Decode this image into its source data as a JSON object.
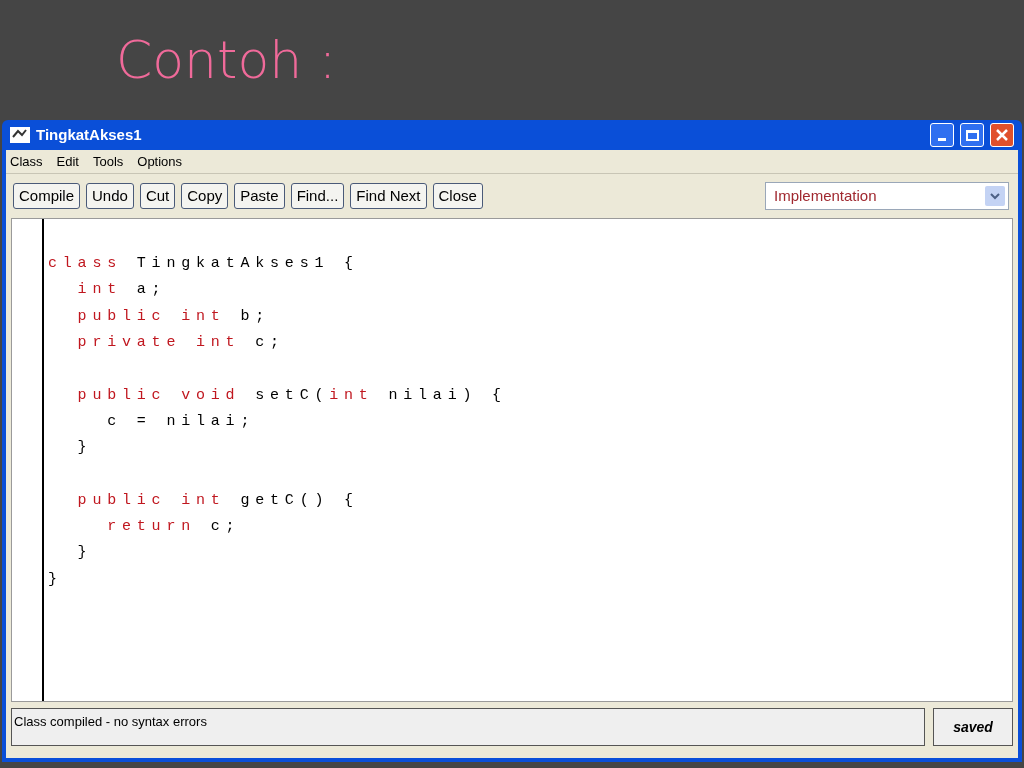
{
  "slide": {
    "title": "Contoh :"
  },
  "window": {
    "title": "TingkatAkses1"
  },
  "menu": [
    "Class",
    "Edit",
    "Tools",
    "Options"
  ],
  "toolbar": [
    "Compile",
    "Undo",
    "Cut",
    "Copy",
    "Paste",
    "Find...",
    "Find Next",
    "Close"
  ],
  "view_select": {
    "value": "Implementation"
  },
  "code": [
    {
      "blank": true
    },
    {
      "tokens": [
        {
          "kind": "keyword",
          "text": "class"
        },
        {
          "kind": "plain",
          "text": " TingkatAkses1 {"
        }
      ]
    },
    {
      "tokens": [
        {
          "kind": "keyword",
          "text": "  int"
        },
        {
          "kind": "plain",
          "text": " a;"
        }
      ]
    },
    {
      "tokens": [
        {
          "kind": "keyword",
          "text": "  public int"
        },
        {
          "kind": "plain",
          "text": " b;"
        }
      ]
    },
    {
      "tokens": [
        {
          "kind": "keyword",
          "text": "  private int"
        },
        {
          "kind": "plain",
          "text": " c;"
        }
      ]
    },
    {
      "blank": true
    },
    {
      "tokens": [
        {
          "kind": "keyword",
          "text": "  public void"
        },
        {
          "kind": "plain",
          "text": " setC("
        },
        {
          "kind": "keyword",
          "text": "int"
        },
        {
          "kind": "plain",
          "text": " nilai) {"
        }
      ]
    },
    {
      "tokens": [
        {
          "kind": "plain",
          "text": "    c = nilai;"
        }
      ]
    },
    {
      "tokens": [
        {
          "kind": "plain",
          "text": "  }"
        }
      ]
    },
    {
      "blank": true
    },
    {
      "tokens": [
        {
          "kind": "keyword",
          "text": "  public int"
        },
        {
          "kind": "plain",
          "text": " getC() {"
        }
      ]
    },
    {
      "tokens": [
        {
          "kind": "keyword",
          "text": "    return"
        },
        {
          "kind": "plain",
          "text": " c;"
        }
      ]
    },
    {
      "tokens": [
        {
          "kind": "plain",
          "text": "  }"
        }
      ]
    },
    {
      "tokens": [
        {
          "kind": "plain",
          "text": "}"
        }
      ]
    }
  ],
  "status_bar": {
    "message": "Class compiled - no syntax errors",
    "state": "saved"
  }
}
